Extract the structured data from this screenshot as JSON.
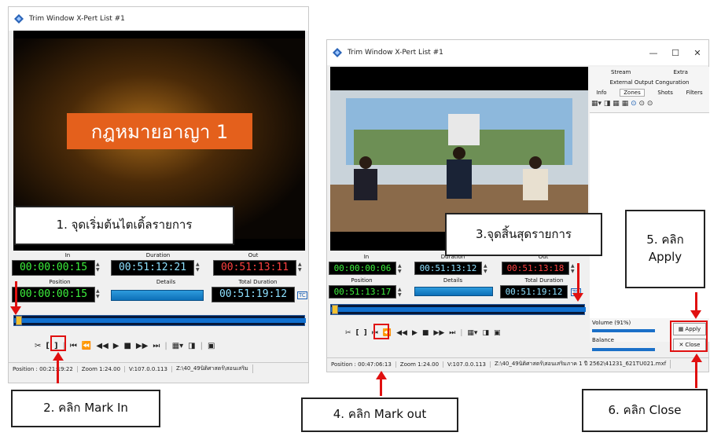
{
  "left_window": {
    "title": "Trim Window X-Pert List #1",
    "video_title_text": "กฎหมายอาญา 1",
    "in_label": "In",
    "duration_label": "Duration",
    "out_label": "Out",
    "in_value": "00:00:00:15",
    "duration_value": "00:51:12:21",
    "out_value": "00:51:13:11",
    "position_label": "Position",
    "details_label": "Details",
    "total_duration_label": "Total Duration",
    "position_value": "00:00:00:15",
    "total_duration_value": "00:51:19:12",
    "tc_badge": "TC",
    "status_position": "Position : 00:21:19:22",
    "status_zoom": "Zoom 1:24.00",
    "status_version": "V:107.0.0.113",
    "status_path": "Z:\\40_49นิติศาสตร์\\สอนเสริม"
  },
  "right_window": {
    "title": "Trim Window X-Pert List #1",
    "minimize": "—",
    "maximize": "☐",
    "close": "✕",
    "in_label": "In",
    "duration_label": "Duration",
    "out_label": "Out",
    "in_value": "00:00:00:06",
    "duration_value": "00:51:13:12",
    "out_value": "00:51:13:18",
    "position_label": "Position",
    "details_label": "Details",
    "total_duration_label": "Total Duration",
    "position_value": "00:51:13:17",
    "total_duration_value": "00:51:19:12",
    "tc_badge": "TC",
    "tabs_row1": [
      "Stream",
      "Extra"
    ],
    "tabs_row2": [
      "External Output Conguration"
    ],
    "tabs_row3": [
      "Info",
      "Zones",
      "Shots",
      "Filters"
    ],
    "volume_label": "Volume (91%)",
    "balance_label": "Balance",
    "apply_label": "Apply",
    "close_label": "Close",
    "status_position": "Position : 00:47:06:13",
    "status_zoom": "Zoom 1:24.00",
    "status_version": "V:107.0.0.113",
    "status_path": "Z:\\40_49นิติศาสตร์\\สอนเสริมภาค 1 ปี 2562\\41231_621TU021.mxf"
  },
  "callouts": {
    "step1": "1. จุดเริ่มต้นไตเติ้ลรายการ",
    "step2": "2. คลิก Mark In",
    "step3": "3.จุดสิ้นสุดรายการ",
    "step4": "4. คลิก Mark out",
    "step5": "5. คลิก\nApply",
    "step6": "6. คลิก Close"
  },
  "colors": {
    "highlight_red": "#e01010",
    "timecode_green": "#3cf03c",
    "timecode_red": "#ff4040",
    "details_blue": "#1b86cc"
  }
}
